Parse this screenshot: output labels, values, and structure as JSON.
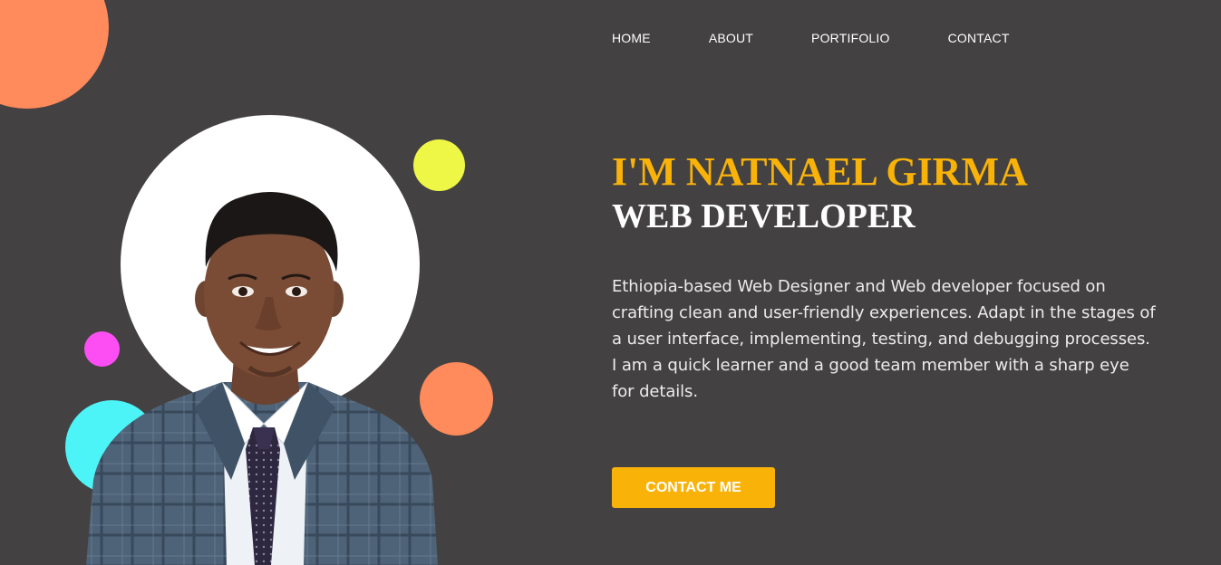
{
  "nav": {
    "items": [
      {
        "label": "HOME"
      },
      {
        "label": "ABOUT"
      },
      {
        "label": "PORTIFOLIO"
      },
      {
        "label": "CONTACT"
      }
    ]
  },
  "hero": {
    "name": "I'M NATNAEL GIRMA",
    "role": "WEB DEVELOPER",
    "bio": "Ethiopia-based Web Designer and Web developer focused on crafting clean and user-friendly experiences. Adapt in the stages of a user interface, implementing, testing, and debugging processes. I am a quick learner and a good team member with a sharp eye for details.",
    "cta_label": "CONTACT ME"
  },
  "colors": {
    "background": "#434142",
    "accent": "#f9b208",
    "text": "#ffffff",
    "deco_orange": "#ff8a5b",
    "deco_yellow": "#eef646",
    "deco_magenta": "#fc4ef3",
    "deco_cyan": "#4df4f7"
  }
}
